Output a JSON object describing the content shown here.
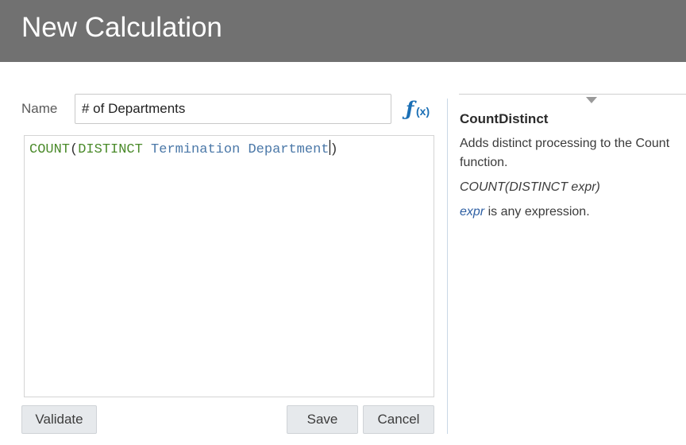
{
  "header": {
    "title": "New Calculation"
  },
  "form": {
    "name_label": "Name",
    "name_value": "# of Departments",
    "fx_icon": "function-fx-icon"
  },
  "editor": {
    "tokens": {
      "fn1": "COUNT",
      "open": "(",
      "fn2": "DISTINCT",
      "space1": " ",
      "col1": "Termination",
      "space2": " ",
      "col2": "Department",
      "close": ")"
    }
  },
  "buttons": {
    "validate": "Validate",
    "save": "Save",
    "cancel": "Cancel"
  },
  "help": {
    "collapse_icon": "caret-down-icon",
    "title": "CountDistinct",
    "description": "Adds distinct processing to the Count function.",
    "syntax": "COUNT(DISTINCT expr)",
    "param_name": "expr",
    "param_text": " is any expression."
  },
  "colors": {
    "header_bg": "#717171",
    "function_token": "#4a8a2a",
    "column_token": "#4b78a8",
    "fx_icon": "#1a6fb5"
  }
}
